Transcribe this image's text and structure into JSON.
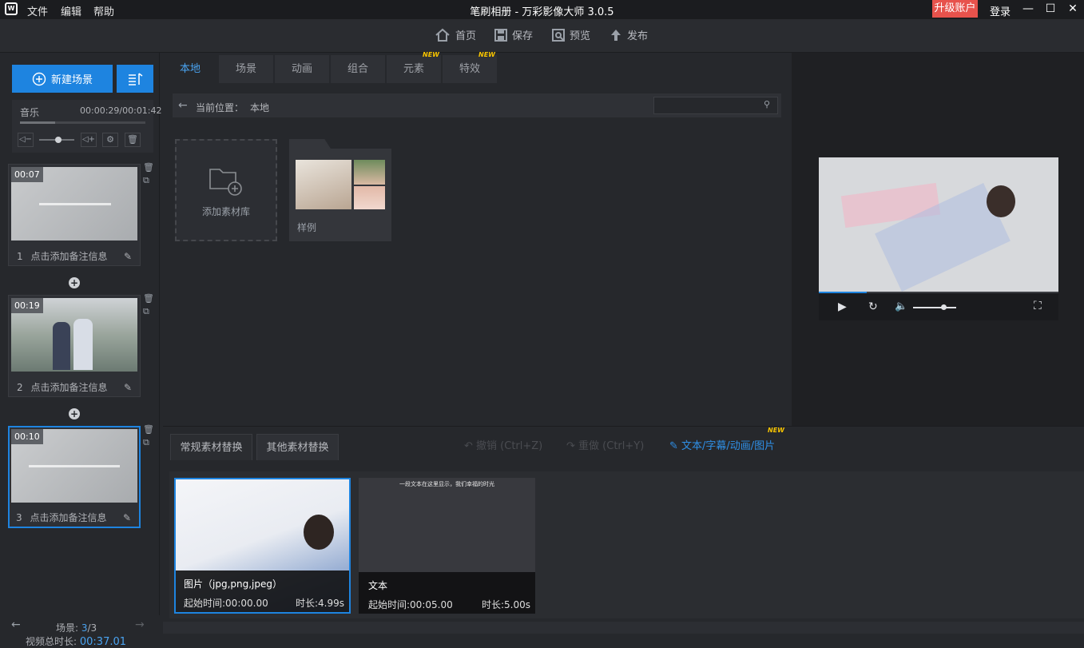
{
  "window": {
    "title": "笔刷相册 - 万彩影像大师 3.0.5",
    "upgrade": "升级账户",
    "login": "登录",
    "minimize": "—",
    "maximize": "☐",
    "close": "✕"
  },
  "menubar": {
    "file": "文件",
    "edit": "编辑",
    "help": "帮助"
  },
  "toolbar": {
    "home": "首页",
    "save": "保存",
    "preview": "预览",
    "publish": "发布"
  },
  "leftpanel": {
    "new_scene": "新建场景",
    "music": {
      "label": "音乐",
      "time": "00:00:29/00:01:42",
      "progress": 0.28,
      "volume": 0.55
    },
    "scenes": [
      {
        "index": "1",
        "duration": "00:07",
        "note": "点击添加备注信息"
      },
      {
        "index": "2",
        "duration": "00:19",
        "note": "点击添加备注信息"
      },
      {
        "index": "3",
        "duration": "00:10",
        "note": "点击添加备注信息"
      }
    ],
    "footer": {
      "scene_label": "场景:",
      "current": "3",
      "total": "/3",
      "total_label": "视频总时长:",
      "total_time": "00:37.01"
    }
  },
  "library": {
    "tabs": [
      {
        "label": "本地",
        "active": true
      },
      {
        "label": "场景"
      },
      {
        "label": "动画"
      },
      {
        "label": "组合"
      },
      {
        "label": "元素",
        "new": true
      },
      {
        "label": "特效",
        "new": true
      }
    ],
    "new_badge": "NEW",
    "location_label": "当前位置：",
    "location_value": "本地",
    "search_placeholder": "",
    "items": [
      {
        "label": "添加素材库"
      },
      {
        "label": "样例"
      }
    ]
  },
  "preview": {
    "progress": 0.2,
    "volume": 0.7
  },
  "bottom": {
    "tabs": [
      {
        "label": "常规素材替换",
        "active": true
      },
      {
        "label": "其他素材替换"
      }
    ],
    "undo": "撤销 (Ctrl+Z)",
    "redo": "重做 (Ctrl+Y)",
    "text_tab": "文本/字幕/动画/图片",
    "new_badge": "NEW",
    "cards": [
      {
        "type": "图片（jpg,png,jpeg）",
        "start": "起始时间:00:00.00",
        "duration": "时长:4.99s"
      },
      {
        "type": "文本",
        "start": "起始时间:00:05.00",
        "duration": "时长:5.00s",
        "caption": "一段文本在这里显示，我们幸福的时光"
      }
    ]
  },
  "colors": {
    "accent": "#1e84e0",
    "upgrade": "#e7524c",
    "new_badge": "#f7c400",
    "bg": "#26282c"
  }
}
